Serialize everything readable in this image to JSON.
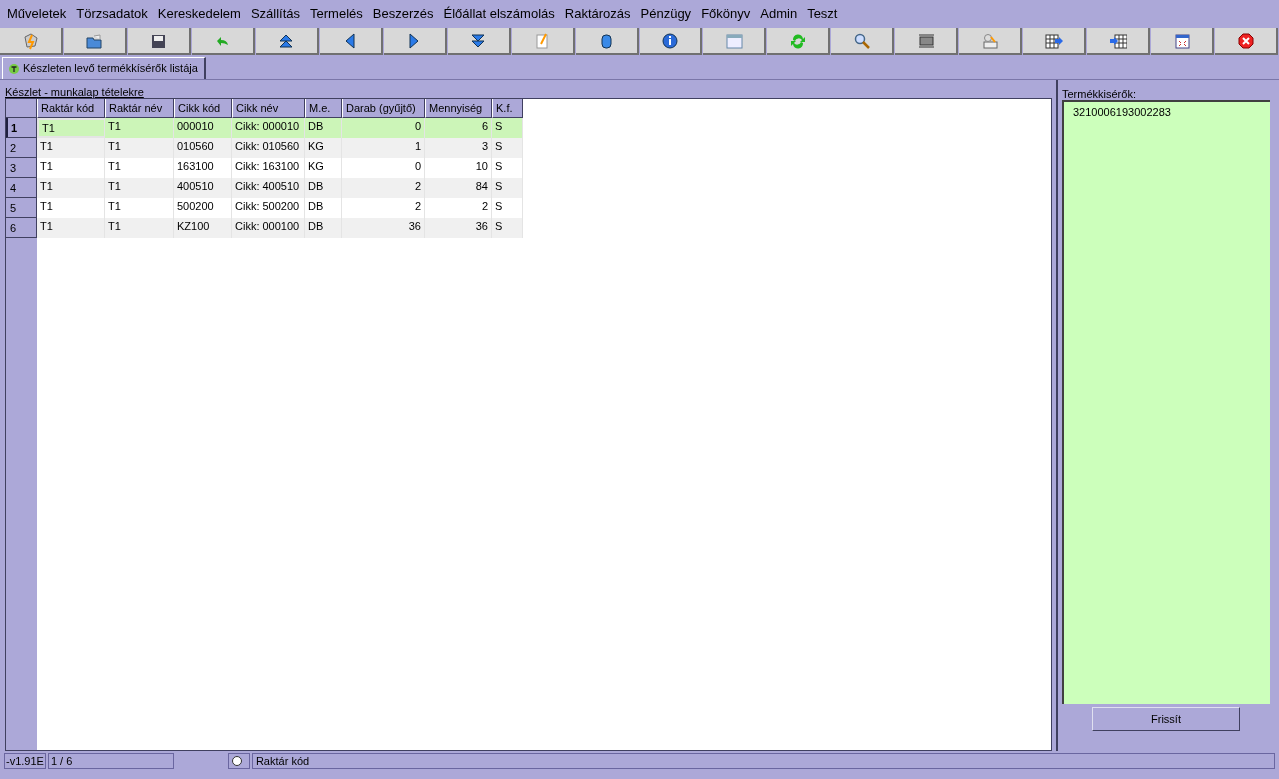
{
  "menu": [
    "Műveletek",
    "Törzsadatok",
    "Kereskedelem",
    "Szállítás",
    "Termelés",
    "Beszerzés",
    "Élőállat elszámolás",
    "Raktározás",
    "Pénzügy",
    "Főkönyv",
    "Admin",
    "Teszt"
  ],
  "tabs": [
    {
      "label": "Készleten levő termékkísérők listája",
      "selected": true
    }
  ],
  "grid_caption": "Készlet - munkalap tételekre",
  "table": {
    "columns": [
      {
        "label": "Raktár kód",
        "kind": "text"
      },
      {
        "label": "Raktár név",
        "kind": "text"
      },
      {
        "label": "Cikk kód",
        "kind": "text"
      },
      {
        "label": "Cikk név",
        "kind": "text"
      },
      {
        "label": "M.e.",
        "kind": "text"
      },
      {
        "label": "Darab (gyűjtő)",
        "kind": "number"
      },
      {
        "label": "Mennyiség",
        "kind": "number"
      },
      {
        "label": "K.f.",
        "kind": "text"
      }
    ],
    "rows": [
      {
        "number": "1",
        "selected": true,
        "cells": [
          "T1",
          "T1",
          "000010",
          "Cikk: 000010",
          "DB",
          "0",
          "6",
          "S"
        ]
      },
      {
        "number": "2",
        "selected": false,
        "cells": [
          "T1",
          "T1",
          "010560",
          "Cikk: 010560",
          "KG",
          "1",
          "3",
          "S"
        ]
      },
      {
        "number": "3",
        "selected": false,
        "cells": [
          "T1",
          "T1",
          "163100",
          "Cikk: 163100",
          "KG",
          "0",
          "10",
          "S"
        ]
      },
      {
        "number": "4",
        "selected": false,
        "cells": [
          "T1",
          "T1",
          "400510",
          "Cikk: 400510",
          "DB",
          "2",
          "84",
          "S"
        ]
      },
      {
        "number": "5",
        "selected": false,
        "cells": [
          "T1",
          "T1",
          "500200",
          "Cikk: 500200",
          "DB",
          "2",
          "2",
          "S"
        ]
      },
      {
        "number": "6",
        "selected": false,
        "cells": [
          "T1",
          "T1",
          "KZ100",
          "Cikk: 000100",
          "DB",
          "36",
          "36",
          "S"
        ]
      }
    ]
  },
  "side_panel": {
    "label": "Termékkisérők:",
    "items": [
      "3210006193002283"
    ],
    "button": "Frissít"
  },
  "status_bar": {
    "version": "-v1.91E",
    "position": "1 / 6",
    "sort_field": "Raktár kód"
  }
}
